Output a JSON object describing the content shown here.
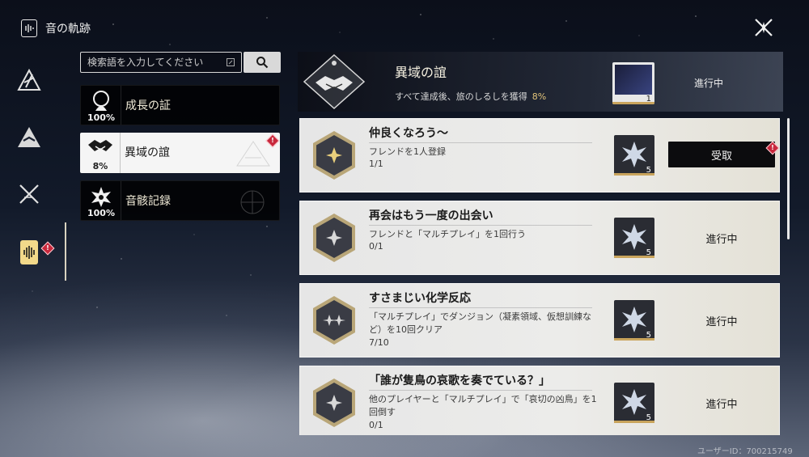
{
  "header": {
    "title": "音の軌跡",
    "icon": "music-record-icon",
    "close_icon": "close-x-icon"
  },
  "rail": {
    "items": [
      {
        "icon": "triangle-crest-icon",
        "active": false
      },
      {
        "icon": "mountain-icon",
        "active": false
      },
      {
        "icon": "crossed-swords-icon",
        "active": false
      },
      {
        "icon": "soundwave-record-icon",
        "active": true,
        "badge": "!"
      }
    ]
  },
  "search": {
    "placeholder": "検索語を入力してください",
    "value": "",
    "button_icon": "search-icon"
  },
  "categories": [
    {
      "label": "成長の証",
      "percent": "100%",
      "icon": "growth-emblem-icon",
      "active": false,
      "badge": ""
    },
    {
      "label": "異域の誼",
      "percent": "8%",
      "icon": "handshake-icon",
      "active": true,
      "badge": "!"
    },
    {
      "label": "音骸記録",
      "percent": "100%",
      "icon": "echo-flower-icon",
      "active": false,
      "badge": ""
    }
  ],
  "banner": {
    "title": "異域の誼",
    "description": "すべて達成後、旅のしるしを獲得",
    "percent": "8%",
    "reward_qty": "1",
    "status": "進行中"
  },
  "quests": [
    {
      "title": "仲良くなろう～",
      "description": "フレンドを1人登録",
      "progress": "1/1",
      "reward_icon": "star-crystal-icon",
      "reward_qty": "5",
      "status": "受取",
      "claimable": true,
      "badge": "!"
    },
    {
      "title": "再会はもう一度の出会い",
      "description": "フレンドと「マルチプレイ」を1回行う",
      "progress": "0/1",
      "reward_icon": "star-crystal-icon",
      "reward_qty": "5",
      "status": "進行中",
      "claimable": false
    },
    {
      "title": "すさまじい化学反応",
      "description": "「マルチプレイ」でダンジョン（凝素領域、仮想訓練など）を10回クリア",
      "progress": "7/10",
      "reward_icon": "star-crystal-icon",
      "reward_qty": "5",
      "status": "進行中",
      "claimable": false
    },
    {
      "title": "「誰が隻鳥の哀歌を奏でている？」",
      "description": "他のプレイヤーと「マルチプレイ」で「哀切の凶鳥」を1回倒す",
      "progress": "0/1",
      "reward_icon": "star-crystal-icon",
      "reward_qty": "5",
      "status": "進行中",
      "claimable": false
    }
  ],
  "footer": {
    "user_id": "ユーザーID：700215749"
  },
  "colors": {
    "accent_gold": "#c9a45c",
    "badge_red": "#c8283c",
    "active_rail": "#f2d98a"
  }
}
